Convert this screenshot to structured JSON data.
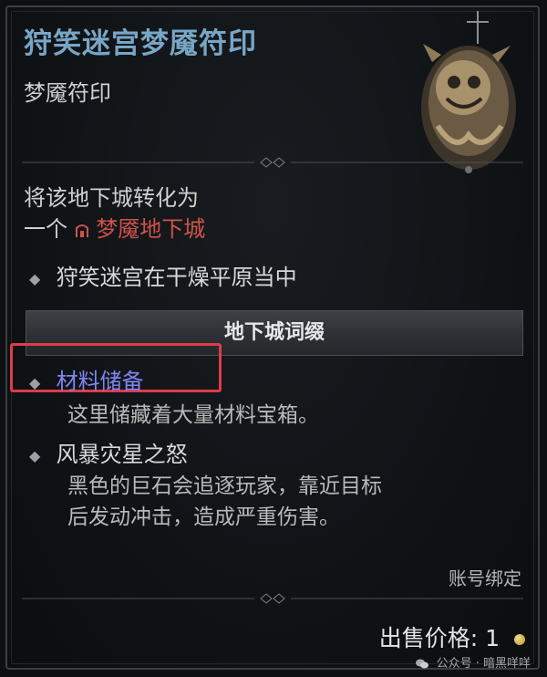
{
  "item": {
    "name": "狩笑迷宫梦魇符印",
    "type": "梦魇符印",
    "description_line1": "将该地下城转化为",
    "description_prefix": "一个",
    "nightmare_dungeon": "梦魇地下城",
    "location": "狩笑迷宫在干燥平原当中"
  },
  "affixes": {
    "header": "地下城词缀",
    "list": [
      {
        "name": "材料储备",
        "desc_lines": [
          "这里储藏着大量材料宝箱。"
        ]
      },
      {
        "name": "风暴灾星之怒",
        "desc_lines": [
          "黑色的巨石会追逐玩家，靠近目标",
          "后发动冲击，造成严重伤害。"
        ]
      }
    ]
  },
  "footer": {
    "bind": "账号绑定",
    "sell_label": "出售价格:",
    "sell_value": "1"
  },
  "watermark": {
    "text": "公众号 · 暗黑咩咩"
  },
  "colors": {
    "title": "#78a6c6",
    "nightmare": "#d0524b",
    "affix_name": "#7f86f0",
    "highlight_box": "#e03a4a"
  },
  "icons": {
    "sigil_art": "nightmare-sigil-icon",
    "dungeon_icon": "dungeon-gate-icon",
    "bullet": "diamond-bullet-icon",
    "coin": "gold-coin-icon",
    "wechat": "wechat-icon"
  }
}
